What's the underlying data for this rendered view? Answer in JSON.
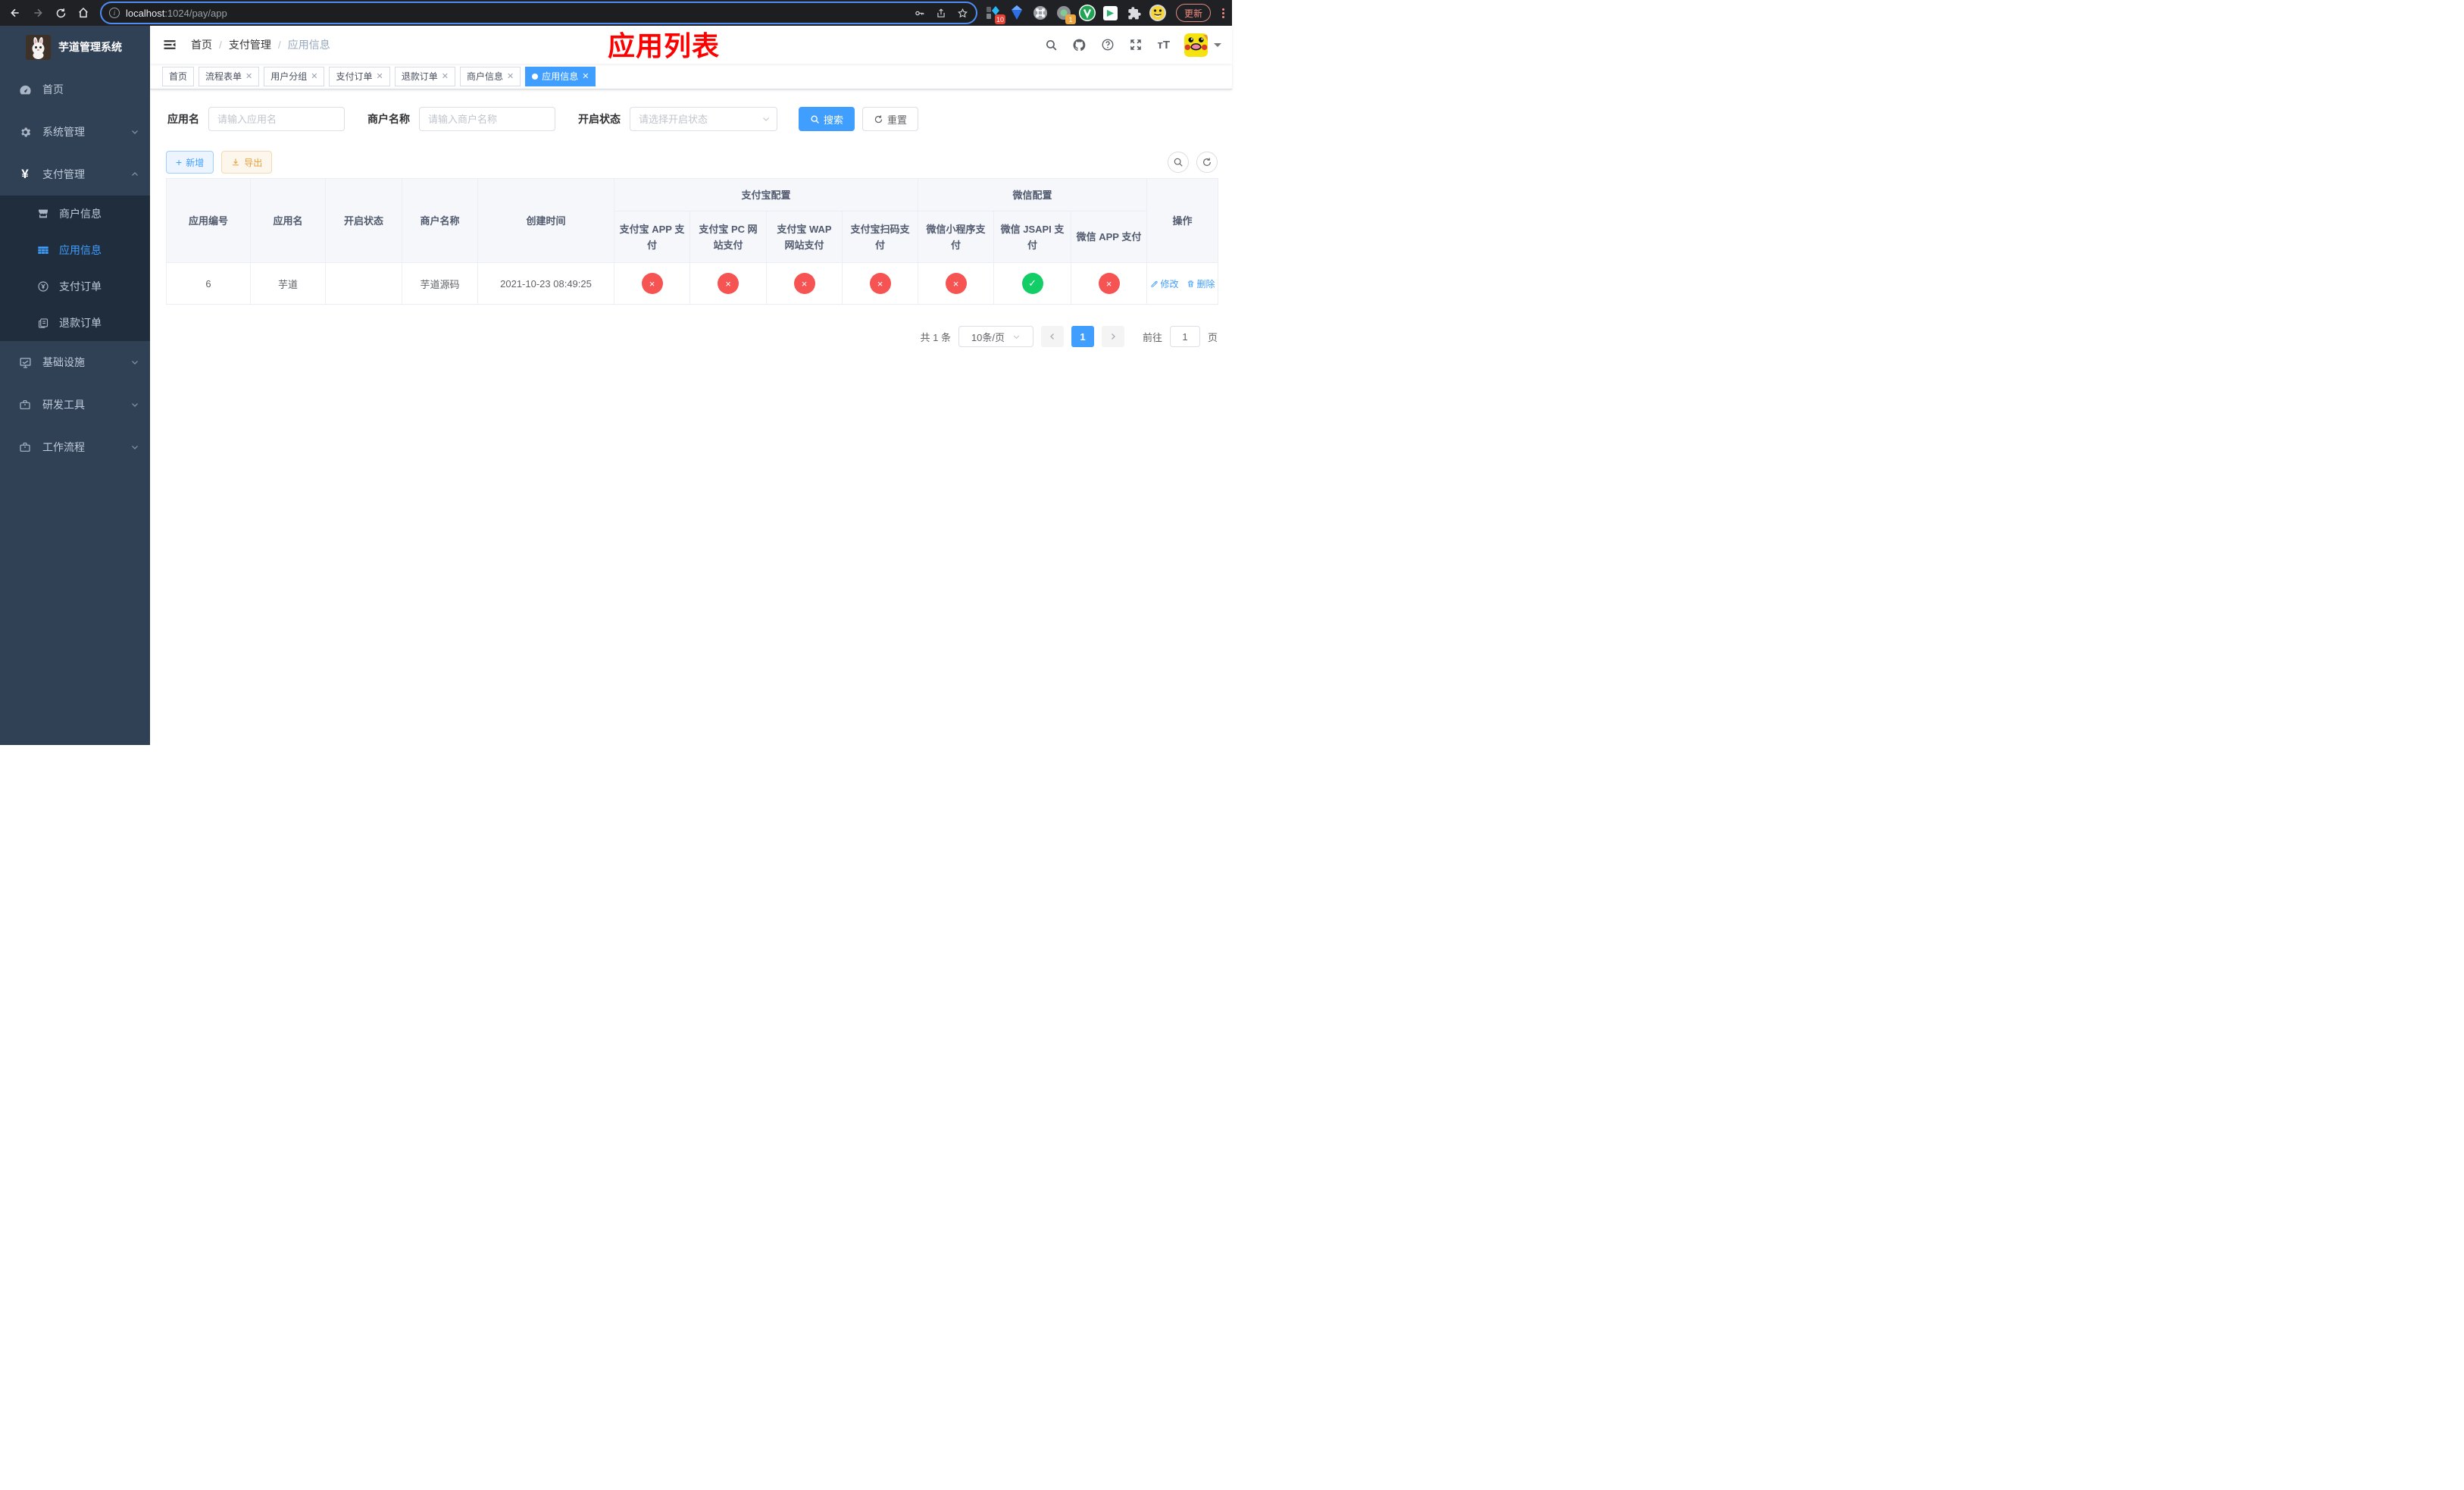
{
  "browser": {
    "url_host": "localhost",
    "url_path": ":1024/pay/app",
    "update_label": "更新",
    "ext_badge_devtools": "10",
    "ext_badge_recorder": "1"
  },
  "sidebar": {
    "title": "芋道管理系统",
    "menu": [
      {
        "label": "首页"
      },
      {
        "label": "系统管理"
      },
      {
        "label": "支付管理"
      },
      {
        "label": "基础设施"
      },
      {
        "label": "研发工具"
      },
      {
        "label": "工作流程"
      }
    ],
    "payment_submenu": [
      {
        "label": "商户信息"
      },
      {
        "label": "应用信息"
      },
      {
        "label": "支付订单"
      },
      {
        "label": "退款订单"
      }
    ]
  },
  "navbar": {
    "breadcrumb": [
      "首页",
      "支付管理",
      "应用信息"
    ],
    "annotation": "应用列表"
  },
  "tabs": [
    {
      "label": "首页"
    },
    {
      "label": "流程表单"
    },
    {
      "label": "用户分组"
    },
    {
      "label": "支付订单"
    },
    {
      "label": "退款订单"
    },
    {
      "label": "商户信息"
    },
    {
      "label": "应用信息"
    }
  ],
  "filters": {
    "app_name_label": "应用名",
    "app_name_placeholder": "请输入应用名",
    "merchant_label": "商户名称",
    "merchant_placeholder": "请输入商户名称",
    "status_label": "开启状态",
    "status_placeholder": "请选择开启状态",
    "search_label": "搜索",
    "reset_label": "重置"
  },
  "toolbar": {
    "add_label": "新增",
    "export_label": "导出"
  },
  "table": {
    "headers": {
      "app_id": "应用编号",
      "app_name": "应用名",
      "status": "开启状态",
      "merchant": "商户名称",
      "created": "创建时间",
      "alipay_group": "支付宝配置",
      "wechat_group": "微信配置",
      "actions": "操作",
      "channels": [
        "支付宝 APP 支付",
        "支付宝 PC 网站支付",
        "支付宝 WAP 网站支付",
        "支付宝扫码支付",
        "微信小程序支付",
        "微信 JSAPI 支付",
        "微信 APP 支付"
      ]
    },
    "row": {
      "app_id": "6",
      "app_name": "芋道",
      "enabled": true,
      "merchant": "芋道源码",
      "created": "2021-10-23 08:49:25",
      "channels": [
        false,
        false,
        false,
        false,
        false,
        true,
        false
      ],
      "edit_label": "修改",
      "delete_label": "删除"
    }
  },
  "pagination": {
    "total": "共 1 条",
    "page_size": "10条/页",
    "current_page": "1",
    "goto_label": "前往",
    "goto_value": "1",
    "page_label": "页"
  },
  "colors": {
    "primary": "#409EFF",
    "success": "#13ce66",
    "danger": "#f65353",
    "sidebar_bg": "#304156",
    "submenu_bg": "#1f2d3d",
    "annotation_red": "#ff0000"
  }
}
